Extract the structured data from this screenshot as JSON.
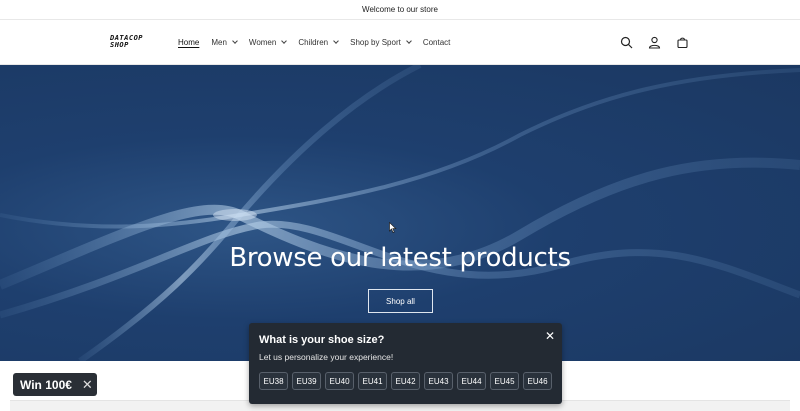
{
  "announcement": "Welcome to our store",
  "brand": {
    "logo_line1": "DATACOP",
    "logo_line2": "SHOP"
  },
  "nav": {
    "items": [
      {
        "label": "Home",
        "active": true,
        "dropdown": false
      },
      {
        "label": "Men",
        "dropdown": true
      },
      {
        "label": "Women",
        "dropdown": true
      },
      {
        "label": "Children",
        "dropdown": true
      },
      {
        "label": "Shop by Sport",
        "dropdown": true
      },
      {
        "label": "Contact",
        "dropdown": false
      }
    ]
  },
  "header_icons": [
    "search-icon",
    "account-icon",
    "cart-icon"
  ],
  "hero": {
    "title": "Browse our latest products",
    "button_label": "Shop all"
  },
  "win_badge": {
    "label": "Win 100€",
    "close": "✕"
  },
  "popup": {
    "title": "What is your shoe size?",
    "subtitle": "Let us personalize your experience!",
    "close": "✕",
    "sizes": [
      "EU38",
      "EU39",
      "EU40",
      "EU41",
      "EU42",
      "EU43",
      "EU44",
      "EU45",
      "EU46"
    ]
  },
  "colors": {
    "hero_bg": "#1e3f6e",
    "popup_bg": "#232a33",
    "badge_bg": "#2a2f36"
  }
}
